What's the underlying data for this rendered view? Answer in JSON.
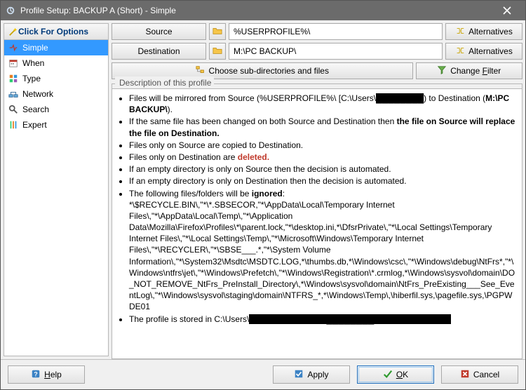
{
  "window": {
    "title": "Profile Setup: BACKUP A (Short) - Simple"
  },
  "sidebar": {
    "header": "Click For Options",
    "items": [
      {
        "label": "Simple",
        "icon": "simple-icon",
        "selected": true
      },
      {
        "label": "When",
        "icon": "when-icon",
        "selected": false
      },
      {
        "label": "Type",
        "icon": "type-icon",
        "selected": false
      },
      {
        "label": "Network",
        "icon": "network-icon",
        "selected": false
      },
      {
        "label": "Search",
        "icon": "search-icon",
        "selected": false
      },
      {
        "label": "Expert",
        "icon": "expert-icon",
        "selected": false
      }
    ]
  },
  "paths": {
    "source_label": "Source",
    "source_value": "%USERPROFILE%\\",
    "dest_label": "Destination",
    "dest_value": "M:\\PC BACKUP\\",
    "alt_label": "Alternatives"
  },
  "actions": {
    "choose_sub": "Choose sub-directories and files",
    "change_filter_pre": "Change ",
    "change_filter_accel": "F",
    "change_filter_post": "ilter"
  },
  "description": {
    "legend": "Description of this profile",
    "li1_a": "Files will be mirrored from Source (%USERPROFILE%\\ [C:\\Users\\",
    "li1_b": ") to Destination (",
    "li1_c": "M:\\PC BACKUP\\",
    "li1_d": ").",
    "li2_a": "If the same file has been changed on both Source and Destination then ",
    "li2_b": "the file on Source will replace the file on Destination.",
    "li3": "Files only on Source are copied to Destination.",
    "li4_a": "Files only on Destination are ",
    "li4_b": "deleted.",
    "li5": "If an empty directory is only on Source then the decision is automated.",
    "li6": "If an empty directory is only on Destination then the decision is automated.",
    "li7_a": "The following files/folders will be ",
    "li7_b": "ignored",
    "li7_c": ": *\\$RECYCLE.BIN\\,\"*\\*.SBSECOR,\"*\\AppData\\Local\\Temporary Internet Files\\,\"*\\AppData\\Local\\Temp\\,\"*\\Application Data\\Mozilla\\Firefox\\Profiles\\*\\parent.lock,\"*\\desktop.ini,*\\DfsrPrivate\\,\"*\\Local Settings\\Temporary Internet Files\\,\"*\\Local Settings\\Temp\\,\"*\\Microsoft\\Windows\\Temporary Internet Files\\,\"*\\RECYCLER\\,\"*\\SBSE___.*,\"*\\System Volume Information\\,\"*\\System32\\Msdtc\\MSDTC.LOG,*\\thumbs.db,*\\Windows\\csc\\,\"*\\Windows\\debug\\NtFrs*,\"*\\Windows\\ntfrs\\jet\\,\"*\\Windows\\Prefetch\\,\"*\\Windows\\Registration\\*.crmlog,*\\Windows\\sysvol\\domain\\DO_NOT_REMOVE_NtFrs_PreInstall_Directory\\,*\\Windows\\sysvol\\domain\\NtFrs_PreExisting___See_EventLog\\,\"*\\Windows\\sysvol\\staging\\domain\\NTFRS_*,*\\Windows\\Temp\\,\\hiberfil.sys,\\pagefile.sys,\\PGPWDE01",
    "li8_a": "The profile is stored in C:\\Users\\"
  },
  "footer": {
    "help_accel": "H",
    "help_post": "elp",
    "apply": "Apply",
    "ok_accel": "O",
    "ok_post": "K",
    "cancel": "Cancel"
  },
  "redacted": "████████"
}
